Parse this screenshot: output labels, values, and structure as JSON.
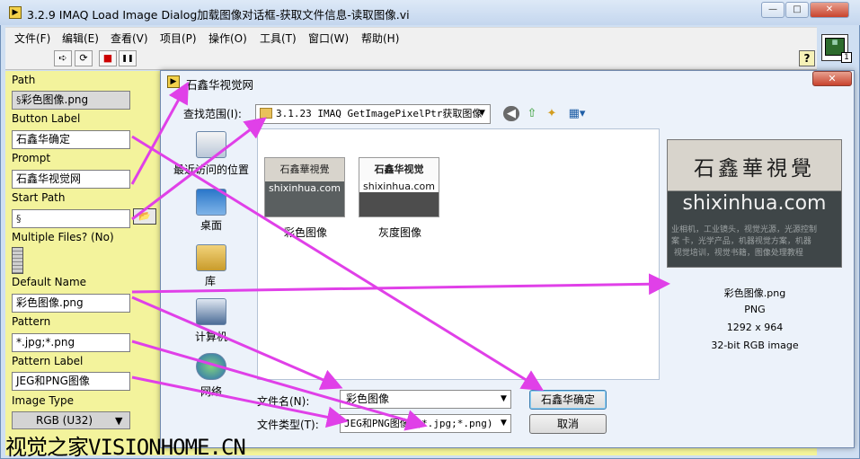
{
  "window": {
    "title": "3.2.9 IMAQ Load Image Dialog加载图像对话框-获取文件信息-读取图像.vi",
    "icon": "labview-vi-icon"
  },
  "menu": [
    "文件(F)",
    "编辑(E)",
    "查看(V)",
    "项目(P)",
    "操作(O)",
    "工具(T)",
    "窗口(W)",
    "帮助(H)"
  ],
  "toolbar": {
    "run": "➪",
    "run_continuous": "⟳",
    "abort": "■",
    "pause": "❚❚",
    "help": "?",
    "vi_count": "1"
  },
  "panel": {
    "path_label": "Path",
    "path_value": "彩色图像.png",
    "button_label_label": "Button Label",
    "button_label_value": "石鑫华确定",
    "prompt_label": "Prompt",
    "prompt_value": "石鑫华视觉网",
    "start_path_label": "Start Path",
    "start_path_value": "",
    "multiple_files_label": "Multiple Files? (No)",
    "default_name_label": "Default Name",
    "default_name_value": "彩色图像.png",
    "pattern_label": "Pattern",
    "pattern_value": "*.jpg;*.png",
    "pattern_label_label": "Pattern Label",
    "pattern_label_value": "JEG和PNG图像",
    "image_type_label": "Image Type",
    "image_type_value": "RGB (U32)"
  },
  "dialog": {
    "title": "石鑫华视觉网",
    "close": "✕",
    "look_in_label": "查找范围(I):",
    "look_in_value": "3.1.23 IMAQ GetImagePixelPtr获取图像",
    "places": [
      "最近访问的位置",
      "桌面",
      "库",
      "计算机",
      "网络"
    ],
    "files": [
      {
        "name": "彩色图像",
        "caption": "石鑫華視覺",
        "url": "shixinhua.com"
      },
      {
        "name": "灰度图像",
        "caption": "石鑫华视觉",
        "url": "shixinhua.com"
      }
    ],
    "preview": {
      "caption": "石鑫華視覺",
      "url": "shixinhua.com",
      "noise": "业相机，工业镜头，视觉光源，光源控制\n案 卡，光学产品，机器视觉方案，机器\n 视觉培训，视觉书籍，图像处理教程",
      "filename": "彩色图像.png",
      "format": "PNG",
      "dimensions": "1292 x 964",
      "depth": "32-bit RGB image"
    },
    "filename_label": "文件名(N):",
    "filename_value": "彩色图像",
    "filetype_label": "文件类型(T):",
    "filetype_value": "JEG和PNG图像 (*.jpg;*.png)",
    "ok_button": "石鑫华确定",
    "cancel_button": "取消"
  },
  "watermark": "视觉之家VISIONHOME.CN",
  "colors": {
    "panel_bg": "#f5f59a",
    "arrow": "#e040e8",
    "dialog_bg": "#ecf2fa"
  }
}
